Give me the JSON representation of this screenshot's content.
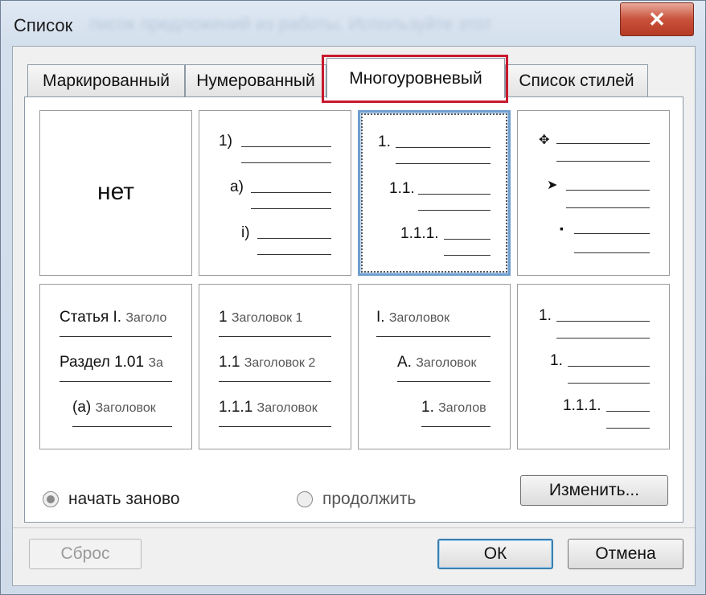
{
  "window": {
    "title": "Список",
    "background_title_fragment": "писок предложений из работы. Используйте этот",
    "close_icon": "close-icon"
  },
  "tabs": [
    {
      "label": "Маркированный",
      "active": false
    },
    {
      "label": "Нумерованный",
      "active": false
    },
    {
      "label": "Многоуровневый",
      "active": true
    },
    {
      "label": "Список стилей",
      "active": false
    }
  ],
  "gallery": {
    "none": {
      "label": "нет"
    },
    "cell2": {
      "l1": "1)",
      "l2": "a)",
      "l3": "i)"
    },
    "cell3": {
      "l1": "1.",
      "l2": "1.1.",
      "l3": "1.1.1."
    },
    "cell4": {
      "l1": "✥",
      "l2": "➤",
      "l3": "▪"
    },
    "cell5": {
      "l1": "Статья I.",
      "l1s": "Заголо",
      "l2": "Раздел 1.01",
      "l2s": "За",
      "l3": "(a)",
      "l3s": "Заголовок"
    },
    "cell6": {
      "l1": "1",
      "l1s": "Заголовок 1",
      "l2": "1.1",
      "l2s": "Заголовок 2",
      "l3": "1.1.1",
      "l3s": "Заголовок"
    },
    "cell7": {
      "l1": "I.",
      "l1s": "Заголовок",
      "l2": "A.",
      "l2s": "Заголовок",
      "l3": "1.",
      "l3s": "Заголов"
    },
    "cell8": {
      "l1": "1.",
      "l2": "1.",
      "l3": "1.1.1."
    }
  },
  "options": {
    "restart": {
      "label": "начать заново",
      "checked": true
    },
    "continue": {
      "label": "продолжить",
      "checked": false
    }
  },
  "buttons": {
    "modify": "Изменить...",
    "reset": "Сброс",
    "ok": "ОК",
    "cancel": "Отмена"
  },
  "colors": {
    "highlight": "#c8192e",
    "selection": "#6f9fd0"
  }
}
